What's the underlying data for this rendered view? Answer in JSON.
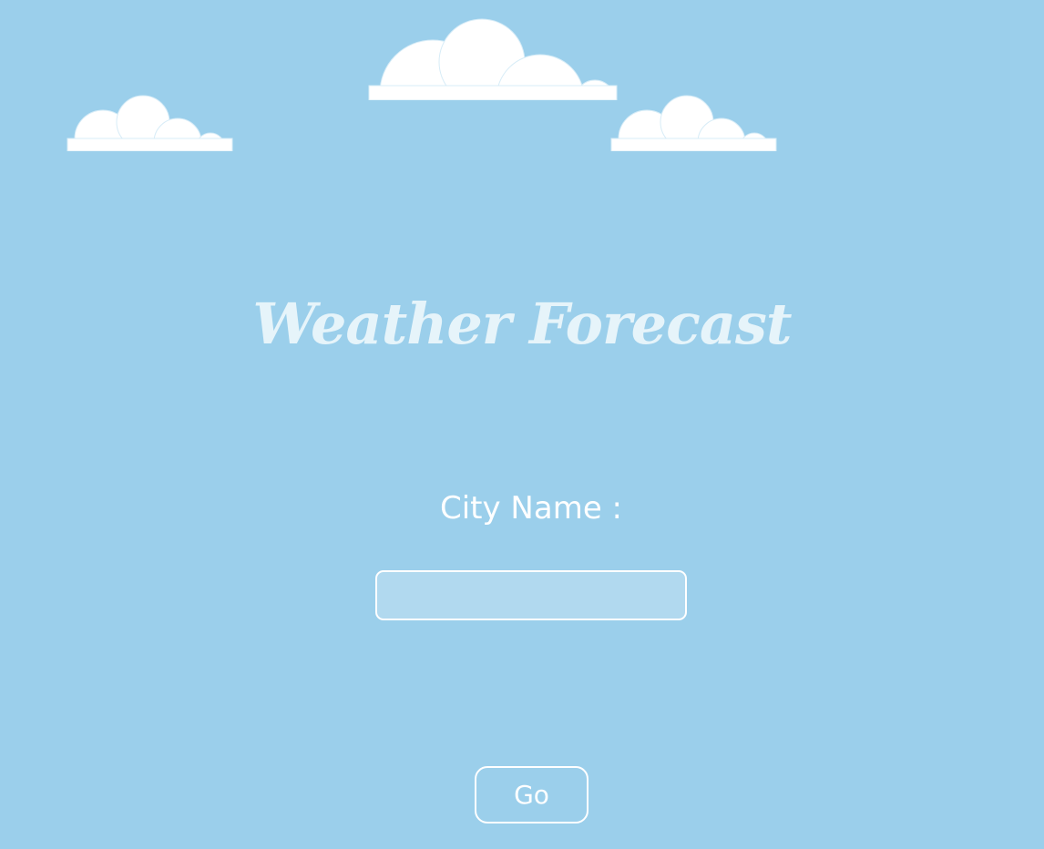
{
  "header": {
    "title": "Weather Forecast"
  },
  "form": {
    "city_label": "City Name :",
    "city_input_value": "",
    "city_input_placeholder": "",
    "go_button_label": "Go"
  },
  "decor": {
    "clouds": [
      "cloud-icon",
      "cloud-icon",
      "cloud-icon"
    ]
  },
  "colors": {
    "background": "#9bcfeb",
    "cloud": "#ffffff",
    "title": "#e6f4fa",
    "text": "#ffffff"
  }
}
